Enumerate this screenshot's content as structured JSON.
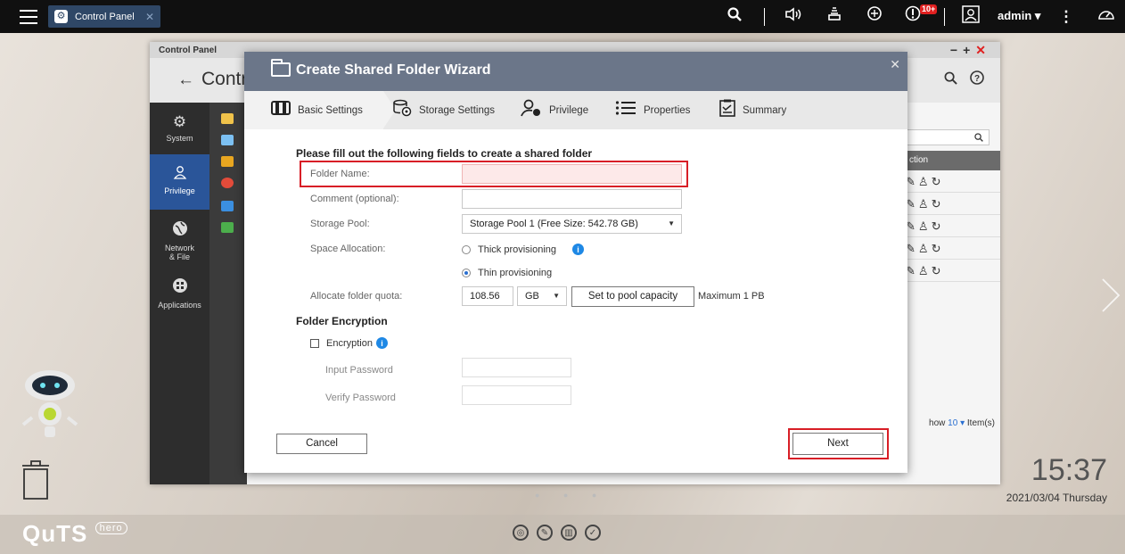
{
  "topbar": {
    "app_tab_label": "Control Panel",
    "notification_badge": "10+",
    "user_label": "admin ▾"
  },
  "control_panel": {
    "window_title": "Control Panel",
    "header_title": "Contr",
    "sidebar": [
      {
        "label": "System",
        "icon": "gear-icon"
      },
      {
        "label": "Privilege",
        "icon": "user-icon",
        "active": true
      },
      {
        "label": "Network & File",
        "icon": "globe-icon"
      },
      {
        "label": "Applications",
        "icon": "apps-icon"
      }
    ],
    "table_header": "ction",
    "row_count": 5,
    "paging": {
      "prefix": "how",
      "page_size": "10",
      "suffix": "Item(s)"
    }
  },
  "wizard": {
    "title": "Create Shared Folder Wizard",
    "steps": [
      {
        "label": "Basic Settings",
        "icon": "basic-settings-icon"
      },
      {
        "label": "Storage Settings",
        "icon": "storage-settings-icon"
      },
      {
        "label": "Privilege",
        "icon": "privilege-icon"
      },
      {
        "label": "Properties",
        "icon": "properties-icon"
      },
      {
        "label": "Summary",
        "icon": "summary-icon"
      }
    ],
    "intro": "Please fill out the following fields to create a shared folder",
    "folder_name_label": "Folder Name:",
    "folder_name_value": "",
    "comment_label": "Comment (optional):",
    "comment_value": "",
    "storage_pool_label": "Storage Pool:",
    "storage_pool_value": "Storage Pool 1 (Free Size: 542.78 GB)",
    "space_allocation_label": "Space Allocation:",
    "thick_label": "Thick provisioning",
    "thin_label": "Thin provisioning",
    "quota_label": "Allocate folder quota:",
    "quota_value": "108.56",
    "quota_unit": "GB",
    "set_pool_capacity_label": "Set to pool capacity",
    "maximum_label": "Maximum  1 PB",
    "encryption_section": "Folder Encryption",
    "encryption_label": "Encryption",
    "input_password_label": "Input Password",
    "verify_password_label": "Verify Password",
    "cancel_label": "Cancel",
    "next_label": "Next"
  },
  "desktop": {
    "time": "15:37",
    "date": "2021/03/04 Thursday",
    "logo_text": "QuTS",
    "logo_badge": "hero"
  },
  "colors": {
    "wizard_header": "#6b7689",
    "active_sidebar": "#2a5599",
    "highlight_red": "#d81e26",
    "info_blue": "#1e88e5"
  }
}
